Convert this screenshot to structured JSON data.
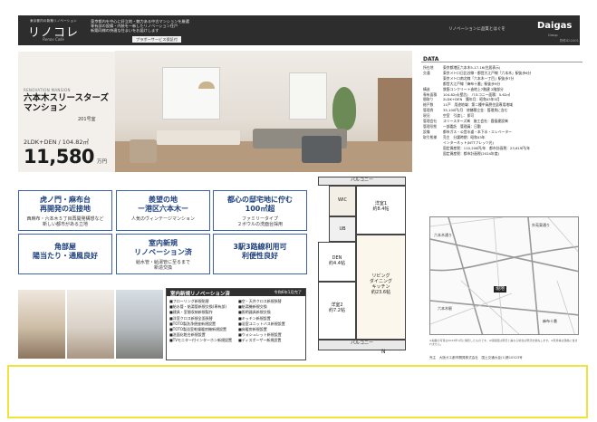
{
  "header": {
    "logo_sub": "東京都内の新築リノベーション",
    "logo_main": "リノコレ",
    "logo_en": "Renov Colle",
    "notes": [
      "東京都内を中心に好立地・魅力ある中古マンションを厳選",
      "専有部の設備・内装を一新したリノベーション住戸",
      "新築同様の快適な住まいをお届けします"
    ],
    "premium_badge": "プラボーサービス保証付",
    "reno_tag": "リノベーションに品質とはぐを",
    "brand": "Daigas",
    "brand_sub": "Group",
    "code": "物件ID:2401"
  },
  "hero": {
    "ren_label": "RENOVATION MANSION",
    "name_line1": "六本木スリースターズ",
    "name_line2": "マンション",
    "room_no": "201号室",
    "layout": "2LDK+DEN / 104.82㎡",
    "price": "11,580",
    "price_unit": "万円"
  },
  "features": [
    {
      "title1": "虎ノ門・麻布台",
      "title2": "再開発の近接地",
      "sub1": "西麻布・六本木５丁目再開発構想など",
      "sub2": "新しい都市がある立地"
    },
    {
      "title1": "羨望の地",
      "title2": "ー港区六本木ー",
      "sub1": "人気のヴィンテージマンション",
      "sub2": ""
    },
    {
      "title1": "都心の邸宅地に佇む",
      "title2": "100㎡超",
      "sub1": "ファミリータイプ",
      "sub2": "２ボウルの洗面台採用"
    },
    {
      "title1": "角部屋",
      "title2": "陽当たり・通風良好",
      "sub1": "",
      "sub2": ""
    },
    {
      "title1": "室内新規",
      "title2": "リノベーション済",
      "sub1": "給水管・給湯管に至るまで",
      "sub2": "新造交換"
    },
    {
      "title1": "3駅3路線利用可",
      "title2": "利便性良好",
      "sub1": "",
      "sub2": ""
    }
  ],
  "renovation": {
    "title": "室内新規リノベーション済",
    "date": "令和6年1月完了",
    "left": [
      "■フローリング新規貼替",
      "■給水管・給湯管新規交換(専有部)",
      "■建具・室間収納新規製作",
      "■洋室クロス新規全面張替",
      "■TOTO製洗浄便座新規設置",
      "■TOTO製浴室乾燥暖房機新規設置",
      "■洗面化粧台新規設置",
      "■TVモニター付インターホン新規設置"
    ],
    "right": [
      "■空・天井クロス新規張替",
      "■給湯機新規交換",
      "■照明器具新規交換",
      "■キッチン新規設置",
      "■浴室ユニットバス新規設置",
      "■床暖房新規設置",
      "■ウォシュレット新規設置",
      "■ディスポーザー新規設置"
    ]
  },
  "plan": {
    "room1_label": "洋室1",
    "room1_size": "約8.4帖",
    "room2_label": "洋室2",
    "room2_size": "約7.2帖",
    "den": "DEN",
    "den_size": "約4.4帖",
    "wic": "WIC",
    "wet": "UB",
    "ldk1": "リビング",
    "ldk2": "ダイニング",
    "ldk3": "キッチン",
    "ldk_size": "約23.6帖",
    "balcony": "バルコニー",
    "compass": "N"
  },
  "data": {
    "head": "DATA",
    "rows": [
      {
        "k": "所在地",
        "v": "東京都港区六本木5-17-16(住居表示)"
      },
      {
        "k": "交通",
        "v": "東京メトロ日比谷線・都営大江戸線「六本木」駅徒歩6分"
      },
      {
        "k": "",
        "v": "東京メトロ南北線「六本木一丁目」駅徒歩7分"
      },
      {
        "k": "",
        "v": "都営大江戸線「麻布十番」駅徒歩9分"
      },
      {
        "k": "構造",
        "v": "鉄筋コンクリート造地上7階建 2階部分"
      },
      {
        "k": "専有面積",
        "v": "104.82㎡(壁芯)　バルコニー面積：5.62㎡"
      },
      {
        "k": "間取り",
        "v": "2LDK+DEN　築年月：昭和43年5月"
      },
      {
        "k": "総戸数",
        "v": "11戸　用途地域：第二種中高層住居専用地域"
      },
      {
        "k": "管理費",
        "v": "35,100円/月　修繕積立金：管理費に含む"
      },
      {
        "k": "現況",
        "v": "空室　引渡し：即可"
      },
      {
        "k": "管理会社",
        "v": "スリースターズ㈱　施工会社：鹿島建設㈱"
      },
      {
        "k": "管理形態",
        "v": "一部委託　管理員：日勤"
      },
      {
        "k": "設備",
        "v": "都市ガス・公営水道・本下水・エレベーター"
      },
      {
        "k": "取引態様",
        "v": "売主　分譲時期：昭和43年"
      },
      {
        "k": "",
        "v": "インターネット(NTTフレッツ光)"
      },
      {
        "k": "",
        "v": "固定資産税：110,208円/年　都市計画税：23,619円/年"
      },
      {
        "k": "",
        "v": "固定資産税：都市計画税(2024年度)"
      }
    ]
  },
  "map": {
    "pin": "現地",
    "labels": [
      "六本木通り",
      "外苑東通り",
      "麻布十番",
      "六本木駅"
    ]
  },
  "disclaimer": "※掲載の写真は2024年1月に撮影したものです。※間取図は現況と異なる場合は現況を優先します。※家具等は価格に含まれません。",
  "company": "売主　大阪ガス都市開発株式会社　国土交通大臣(1)第10523号"
}
